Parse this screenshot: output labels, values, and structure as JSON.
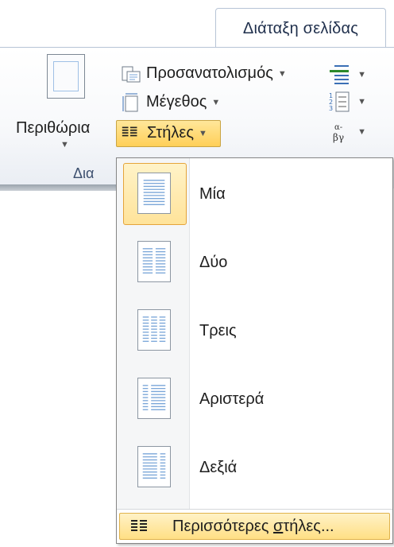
{
  "ribbon": {
    "tab_label": "Διάταξη σελίδας",
    "group_label": "Δια",
    "margins_label": "Περιθώρια",
    "orientation_label": "Προσανατολισμός",
    "size_label": "Μέγεθος",
    "columns_label": "Στήλες",
    "hyphenation_icon_text": "α-\nβγ"
  },
  "columns_menu": {
    "items": [
      {
        "label": "Μία",
        "selected": true
      },
      {
        "label": "Δύο",
        "selected": false
      },
      {
        "label": "Τρεις",
        "selected": false
      },
      {
        "label": "Αριστερά",
        "selected": false
      },
      {
        "label": "Δεξιά",
        "selected": false
      }
    ],
    "more_columns_label": "Περισσότερες στήλες...",
    "more_columns_prefix": "Περισσότερες ",
    "more_columns_mnemonic": "σ",
    "more_columns_suffix": "τήλες..."
  },
  "colors": {
    "accent_highlight": "#ffd66b",
    "accent_border": "#e5a43a",
    "ribbon_border": "#b7c4d6",
    "text": "#1e1e1e"
  }
}
